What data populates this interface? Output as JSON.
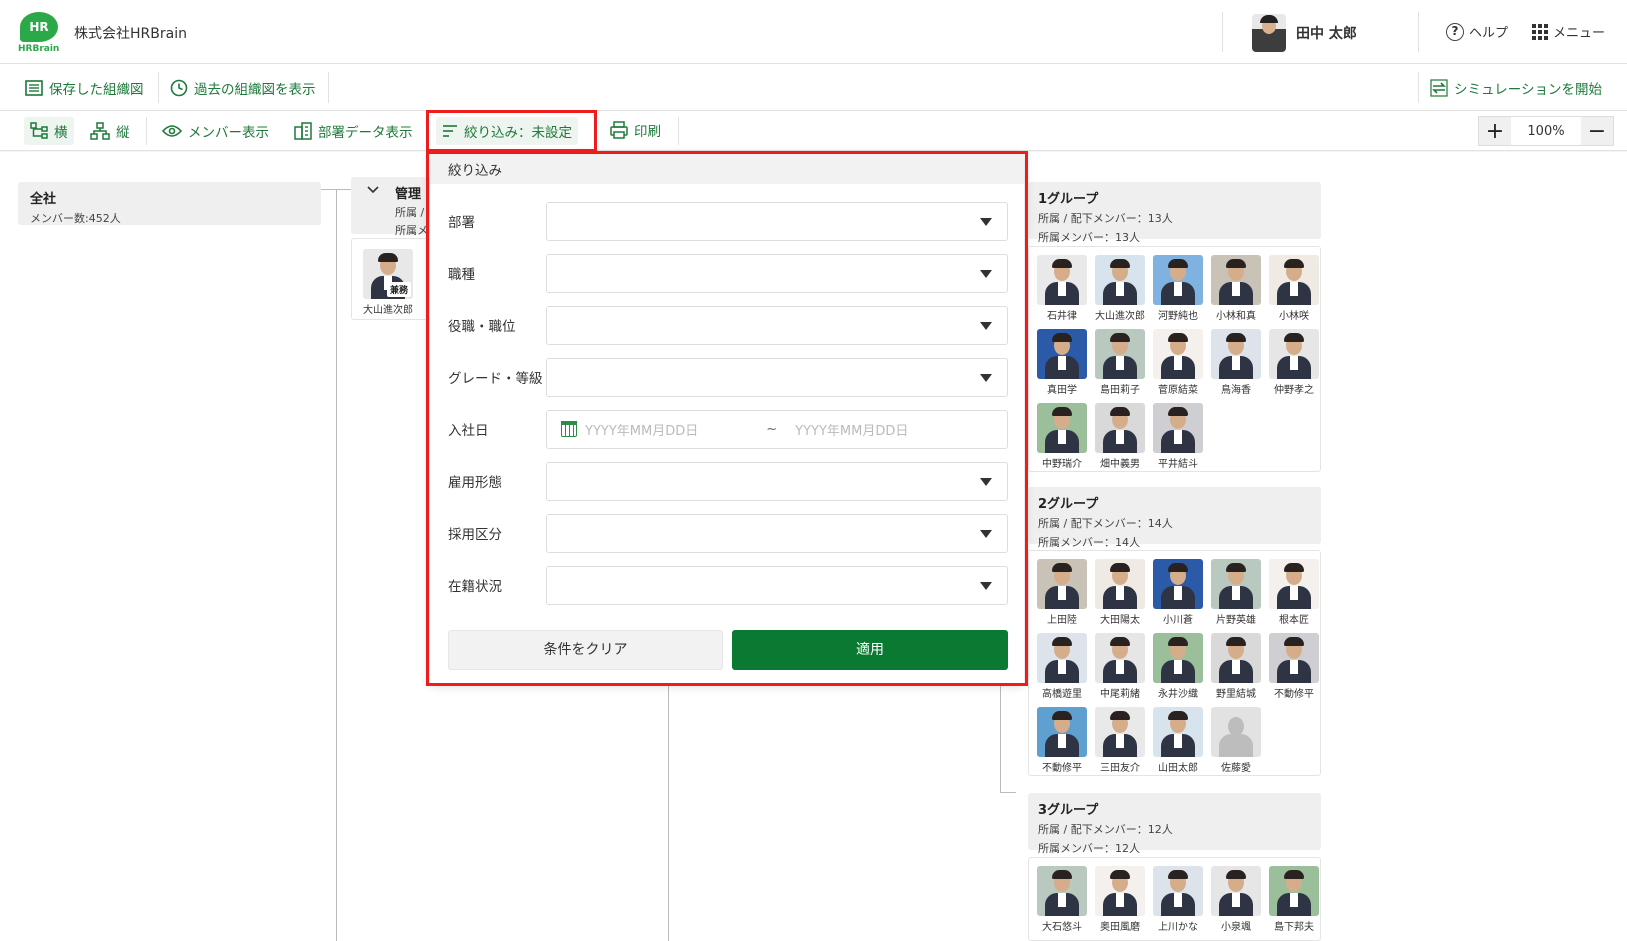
{
  "header": {
    "logo_text": "HR",
    "logo_sub": "HRBrain",
    "company": "株式会社HRBrain",
    "user_name": "田中 太郎",
    "help_label": "ヘルプ",
    "menu_label": "メニュー"
  },
  "toolbar1": {
    "saved_chart": "保存した組織図",
    "past_chart": "過去の組織図を表示",
    "start_sim": "シミュレーションを開始"
  },
  "toolbar2": {
    "horizontal": "横",
    "vertical": "縦",
    "member_view": "メンバー表示",
    "dept_data_view": "部署データ表示",
    "filter": "絞り込み：未設定",
    "print": "印刷",
    "zoom": "100%"
  },
  "colors": {
    "accent": "#0a7a32",
    "highlight": "#ee1c1c"
  },
  "org": {
    "root": {
      "title": "全社",
      "count": "メンバー数:452人"
    },
    "mgmt": {
      "title": "管理",
      "line1": "所属 /",
      "line2": "所属メ"
    },
    "mgmt_member": {
      "name": "大山進次郎",
      "badge": "兼務"
    },
    "groups": [
      {
        "title": "1グループ",
        "line1": "所属 / 配下メンバー：13人",
        "line2": "所属メンバー：13人",
        "members": [
          "石井律",
          "大山進次郎",
          "河野純也",
          "小林和真",
          "小林咲",
          "真田学",
          "島田莉子",
          "菅原結菜",
          "鳥海香",
          "仲野孝之",
          "中野瑞介",
          "畑中義男",
          "平井結斗"
        ]
      },
      {
        "title": "2グループ",
        "line1": "所属 / 配下メンバー：14人",
        "line2": "所属メンバー：14人",
        "members": [
          "上田陸",
          "大田陽太",
          "小川蒼",
          "片野英雄",
          "根本匠",
          "高橋遊里",
          "中尾莉緒",
          "永井沙織",
          "野里結城",
          "不動修平",
          "不動修平",
          "三田友介",
          "山田太郎",
          "佐藤愛"
        ]
      },
      {
        "title": "3グループ",
        "line1": "所属 / 配下メンバー：12人",
        "line2": "所属メンバー：12人",
        "members": [
          "大石悠斗",
          "奥田風磨",
          "上川かな",
          "小泉颯",
          "島下邦夫"
        ]
      }
    ]
  },
  "filter_panel": {
    "title": "絞り込み",
    "fields": [
      "部署",
      "職種",
      "役職・職位",
      "グレード・等級",
      "入社日",
      "雇用形態",
      "採用区分",
      "在籍状況"
    ],
    "date_placeholder": "YYYY年MM月DD日",
    "date_sep": "~",
    "clear_label": "条件をクリア",
    "apply_label": "適用"
  }
}
